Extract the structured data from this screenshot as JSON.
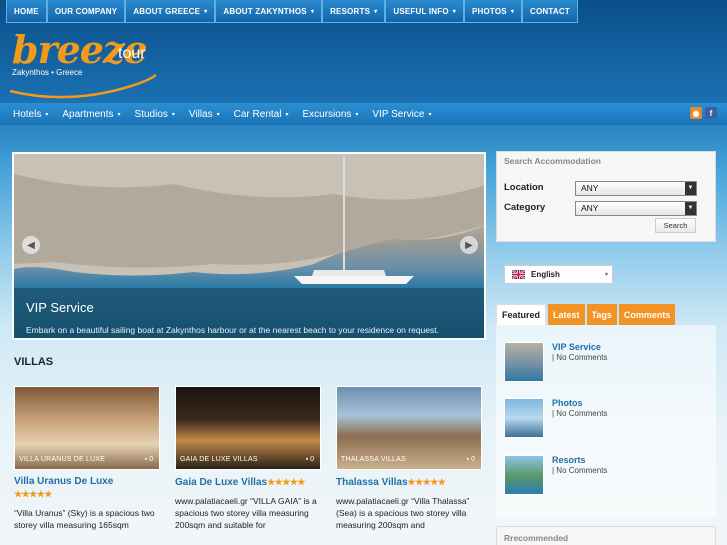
{
  "topnav": {
    "items": [
      {
        "label": "HOME",
        "caret": false
      },
      {
        "label": "OUR COMPANY",
        "caret": false
      },
      {
        "label": "ABOUT GREECE",
        "caret": true
      },
      {
        "label": "ABOUT ZAKYNTHOS",
        "caret": true
      },
      {
        "label": "RESORTS",
        "caret": true
      },
      {
        "label": "USEFUL INFO",
        "caret": true
      },
      {
        "label": "PHOTOS",
        "caret": true
      },
      {
        "label": "CONTACT",
        "caret": false
      }
    ]
  },
  "logo": {
    "main": "breeze",
    "tour": "tour",
    "subtitle": "Zakynthos • Greece"
  },
  "mainmenu": {
    "items": [
      "Hotels",
      "Apartments",
      "Studios",
      "Villas",
      "Car Rental",
      "Excursions",
      "VIP Service"
    ]
  },
  "slider": {
    "title": "VIP Service",
    "text": "Embark on a beautiful sailing boat at Zakynthos harbour or at the nearest beach to your residence on request."
  },
  "villas": {
    "heading": "VILLAS",
    "cards": [
      {
        "label": "VILLA URANUS DE LUXE",
        "comments": "0",
        "title": "Villa Uranus De Luxe",
        "stars": "★★★★★",
        "desc": "“Villa Uranus” (Sky) is a spacious two storey villa measuring 165sqm"
      },
      {
        "label": "GAIA DE LUXE VILLAS",
        "comments": "0",
        "title": "Gaia De Luxe Villas",
        "stars": "★★★★★",
        "desc": "www.palatiacaeli.gr  “VILLA GAIA” is a spacious two storey villa measuring 200sqm and suitable for"
      },
      {
        "label": "THALASSA VILLAS",
        "comments": "0",
        "title": "Thalassa Villas",
        "stars": "★★★★★",
        "desc": "www.palatiacaeli.gr  “Villa Thalassa” (Sea) is a spacious two storey villa measuring 200sqm and"
      }
    ]
  },
  "search": {
    "heading": "Search Accommodation",
    "location_label": "Location",
    "location_value": "ANY",
    "category_label": "Category",
    "category_value": "ANY",
    "button": "Search"
  },
  "language": {
    "selected": "English"
  },
  "tabs": [
    "Featured",
    "Latest",
    "Tags",
    "Comments"
  ],
  "posts": [
    {
      "title": "VIP Service",
      "meta": "| No Comments"
    },
    {
      "title": "Photos",
      "meta": "| No Comments"
    },
    {
      "title": "Resorts",
      "meta": "| No Comments"
    }
  ],
  "recommended": {
    "heading": "Rrecommended"
  },
  "colors": {
    "accent": "#f29323",
    "link": "#1f6fa8",
    "nav": "#1b73b6"
  }
}
